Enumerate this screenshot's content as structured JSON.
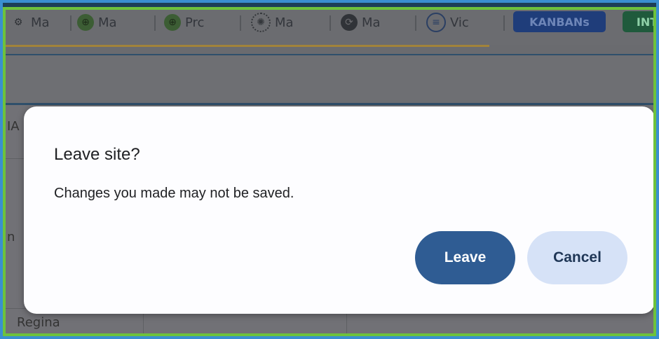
{
  "toolbar": {
    "tabs": [
      {
        "label": "Ma",
        "icon": "app-icon"
      },
      {
        "label": "Ma",
        "icon": "green-circle-icon"
      },
      {
        "label": "Prc",
        "icon": "green-circle-icon"
      },
      {
        "label": "Ma",
        "icon": "gear-circle-icon"
      },
      {
        "label": "Ma",
        "icon": "sync-icon"
      },
      {
        "label": "Vic",
        "icon": "list-circle-icon"
      }
    ],
    "kanban_label": "KANBANs",
    "int_label": "INT"
  },
  "background": {
    "frag_ia": "IA",
    "frag_n": "n",
    "frag_regina": "Regina"
  },
  "dialog": {
    "title": "Leave site?",
    "message": "Changes you made may not be saved.",
    "leave_label": "Leave",
    "cancel_label": "Cancel"
  },
  "colors": {
    "leave_button": "#2f5c93",
    "cancel_button": "#d6e2f7",
    "outer_border": "#3a8fd0",
    "inner_border": "#6dc23c"
  }
}
